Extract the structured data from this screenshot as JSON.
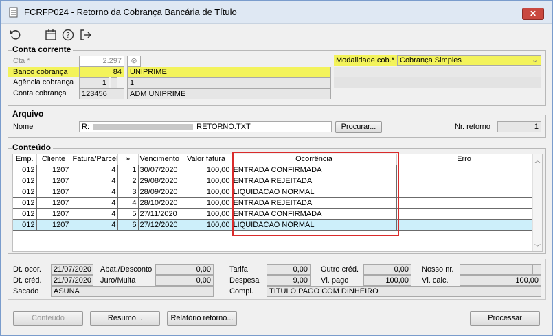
{
  "window": {
    "title": "FCRFP024 - Retorno da Cobrança Bancária de Título",
    "close": "✕"
  },
  "toolbar": {
    "icons": [
      "undo-icon",
      "calendar-icon",
      "help-icon",
      "exit-icon"
    ]
  },
  "conta_corrente": {
    "title": "Conta corrente",
    "cta_label": "Cta *",
    "cta_value": "2.297",
    "banco_label": "Banco cobrança",
    "banco_code": "84",
    "banco_name": "UNIPRIME",
    "agencia_label": "Agência cobrança",
    "agencia_code": "1",
    "agencia_name": "1",
    "conta_label": "Conta cobrança",
    "conta_code": "123456",
    "conta_name": "ADM UNIPRIME",
    "modalidade_label": "Modalidade cob.*",
    "modalidade_value": "Cobrança Simples"
  },
  "arquivo": {
    "title": "Arquivo",
    "nome_label": "Nome",
    "nome_prefix": "R:",
    "nome_value": "RETORNO.TXT",
    "procurar_label": "Procurar...",
    "nr_retorno_label": "Nr. retorno",
    "nr_retorno_value": "1"
  },
  "conteudo": {
    "title": "Conteúdo",
    "columns": [
      "Emp.",
      "Cliente",
      "Fatura/Parcela",
      "»",
      "Vencimento",
      "Valor fatura",
      "Ocorrência",
      "Erro"
    ],
    "rows": [
      {
        "emp": "012",
        "cliente": "1207",
        "fatura": "4",
        "parcela": "1",
        "venc": "30/07/2020",
        "valor": "100,00",
        "ocorrencia": "ENTRADA CONFIRMADA",
        "erro": ""
      },
      {
        "emp": "012",
        "cliente": "1207",
        "fatura": "4",
        "parcela": "2",
        "venc": "29/08/2020",
        "valor": "100,00",
        "ocorrencia": "ENTRADA REJEITADA",
        "erro": ""
      },
      {
        "emp": "012",
        "cliente": "1207",
        "fatura": "4",
        "parcela": "3",
        "venc": "28/09/2020",
        "valor": "100,00",
        "ocorrencia": "LIQUIDACAO NORMAL",
        "erro": ""
      },
      {
        "emp": "012",
        "cliente": "1207",
        "fatura": "4",
        "parcela": "4",
        "venc": "28/10/2020",
        "valor": "100,00",
        "ocorrencia": "ENTRADA REJEITADA",
        "erro": ""
      },
      {
        "emp": "012",
        "cliente": "1207",
        "fatura": "4",
        "parcela": "5",
        "venc": "27/11/2020",
        "valor": "100,00",
        "ocorrencia": "ENTRADA CONFIRMADA",
        "erro": ""
      },
      {
        "emp": "012",
        "cliente": "1207",
        "fatura": "4",
        "parcela": "6",
        "venc": "27/12/2020",
        "valor": "100,00",
        "ocorrencia": "LIQUIDACAO NORMAL",
        "erro": ""
      }
    ]
  },
  "detalhes": {
    "dt_ocor_label": "Dt. ocor.",
    "dt_ocor": "21/07/2020",
    "dt_cred_label": "Dt. créd.",
    "dt_cred": "21/07/2020",
    "abat_label": "Abat./Desconto",
    "abat": "0,00",
    "juro_label": "Juro/Multa",
    "juro": "0,00",
    "tarifa_label": "Tarifa",
    "tarifa": "0,00",
    "despesa_label": "Despesa",
    "despesa": "9,00",
    "outro_label": "Outro créd.",
    "outro": "0,00",
    "vl_pago_label": "Vl. pago",
    "vl_pago": "100,00",
    "nosso_label": "Nosso nr.",
    "nosso": "",
    "vl_calc_label": "Vl. calc.",
    "vl_calc": "100,00",
    "sacado_label": "Sacado",
    "sacado": "ASUNA",
    "compl_label": "Compl.",
    "compl": "TITULO PAGO COM DINHEIRO"
  },
  "buttons": {
    "conteudo": "Conteúdo",
    "resumo": "Resumo...",
    "relatorio": "Relatório retorno...",
    "processar": "Processar"
  }
}
